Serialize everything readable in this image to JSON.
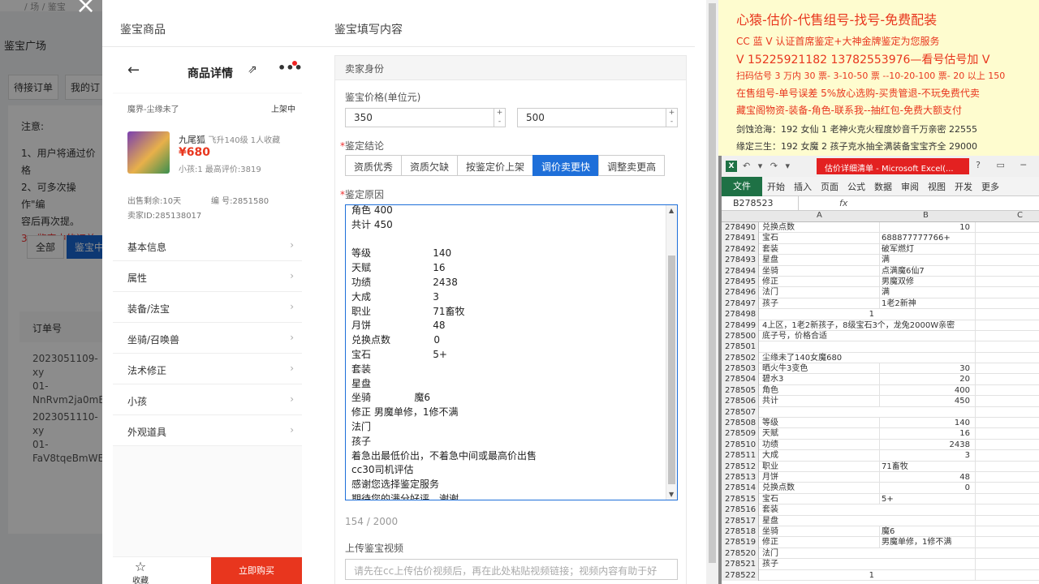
{
  "background": {
    "topbar": "/  场  /  鉴宝",
    "page_title": "鉴宝广场",
    "tabs": [
      "待接订单",
      "我的订"
    ],
    "notice_title": "注意:",
    "notice_lines": [
      "1、用户将通过价格",
      "2、可多次操作\"编",
      "容后再次提。"
    ],
    "notice_red": "3、鉴定中的订单",
    "filter_all": "全部",
    "filter_active": "鉴宝中",
    "order_header": "订单号",
    "orders": [
      [
        "2023051109-xy",
        "01-",
        "NnRvm2ja0mE"
      ],
      [
        "2023051110-xy",
        "01-",
        "FaV8tqeBmWE"
      ]
    ]
  },
  "modal": {
    "close_icon": "×",
    "left_header": "鉴宝商品",
    "right_header": "鉴宝填写内容"
  },
  "phone": {
    "back_icon": "←",
    "title": "商品详情",
    "share_icon": "⇗",
    "more_icon": "•••",
    "zone": "魔界-尘缘未了",
    "status": "上架中",
    "name": "九尾狐",
    "meta": "飞升140级   1人收藏",
    "price": "¥680",
    "child_info": "小孩:1 最高评价:3819",
    "remaining": "出售剩余:10天",
    "serial": "编 号:2851580",
    "seller_id": "卖家ID:285138017",
    "menu": [
      "基本信息",
      "属性",
      "装备/法宝",
      "坐骑/召唤兽",
      "法术修正",
      "小孩",
      "外观道具"
    ],
    "fav_icon": "☆",
    "fav_label": "收藏",
    "buy_label": "立即购买"
  },
  "form": {
    "section": "卖家身份",
    "price_label": "鉴宝价格(单位元)",
    "price_low": "350",
    "price_high": "500",
    "verdict_label": "鉴定结论",
    "verdicts": [
      "资质优秀",
      "资质欠缺",
      "按鉴定价上架",
      "调价卖更快",
      "调整卖更高"
    ],
    "active_verdict": 3,
    "reason_label": "鉴定原因",
    "reason_lines": [
      "角色 400",
      "共计 450",
      "",
      "等级                    140",
      "天赋                    16",
      "功绩                    2438",
      "大成                    3",
      "职业                    71畜牧",
      "月饼                    48",
      "兑换点数              0",
      "宝石                    5+",
      "套装",
      "星盘",
      "坐骑              魔6",
      "修正 男魔单修，1修不满",
      "法门",
      "孩子",
      "着急出最低价出，不着急中间或最高价出售",
      "cc30司机评估",
      "感谢您选择鉴定服务",
      "期待您的满分好评，谢谢"
    ],
    "counter": "154 / 2000",
    "video_label": "上传鉴宝视频",
    "video_placeholder": "请先在cc上传估价视频后，再在此处粘贴视频链接；视频内容有助于好"
  },
  "ad": {
    "line1": "心猿-估价-代售组号-找号-免费配装",
    "line2": "CC 蓝 V 认证首席鉴定+大神金牌鉴定为您服务",
    "line3": "V 15225921182     13782553976—看号估号加 V",
    "line4": "扫码估号 3 万内 30 票- 3-10-50 票  --10-20-100 票- 20 以上 150",
    "line5": "在售组号-单号误差 5%放心选购-买贵管退-不玩免费代卖",
    "line6": "藏宝阁物资-装备-角色-联系我--抽红包-免费大额支付",
    "line7": "剑蚀沧海：192 女仙 1 老神火克火程度妙音千万亲密 22555",
    "line8": "缘定三生：192 女魔 2 孩子克水抽全满装备宝宝齐全 29000"
  },
  "excel": {
    "qa": "↶ ▾ ↷ ▾",
    "filename": "估价详细清单 - Microsoft Excel(...",
    "win_controls": "?  ▭  ─",
    "file_tab": "文件",
    "tabs": [
      "开始",
      "插入",
      "页面",
      "公式",
      "数据",
      "审阅",
      "视图",
      "开发",
      "更多"
    ],
    "namebox": "B278523",
    "fx": "fx",
    "cols": [
      "A",
      "B",
      "C"
    ],
    "rows": [
      [
        "278490",
        "兑换点数",
        "10",
        "num"
      ],
      [
        "278491",
        "宝石",
        "688877777766+",
        "txt"
      ],
      [
        "278492",
        "套装",
        "破军燃灯",
        "txt"
      ],
      [
        "278493",
        "星盘",
        "满",
        "txt"
      ],
      [
        "278494",
        "坐骑",
        "点满魔6仙7",
        "txt"
      ],
      [
        "278495",
        "修正",
        "男魔双修",
        "txt"
      ],
      [
        "278496",
        "法门",
        "满",
        "txt"
      ],
      [
        "278497",
        "孩子",
        "1老2新神",
        "txt"
      ],
      [
        "278498",
        "",
        "1",
        "numA"
      ],
      [
        "278499",
        "4上区，1老2新孩子，8级宝石3个，龙兔2000W亲密",
        "",
        "txt"
      ],
      [
        "278500",
        "底子号，价格合适",
        "",
        "txt"
      ],
      [
        "278501",
        "",
        "",
        "txt"
      ],
      [
        "278502",
        "尘缘未了140女魔680",
        "",
        "txt"
      ],
      [
        "278503",
        "晒火牛3变色",
        "30",
        "num"
      ],
      [
        "278504",
        "碧水3",
        "20",
        "num"
      ],
      [
        "278505",
        "角色",
        "400",
        "num"
      ],
      [
        "278506",
        "共计",
        "450",
        "num"
      ],
      [
        "278507",
        "",
        "",
        "txt"
      ],
      [
        "278508",
        "等级",
        "140",
        "num"
      ],
      [
        "278509",
        "天赋",
        "16",
        "num"
      ],
      [
        "278510",
        "功绩",
        "2438",
        "num"
      ],
      [
        "278511",
        "大成",
        "3",
        "num"
      ],
      [
        "278512",
        "职业",
        "71畜牧",
        "txt"
      ],
      [
        "278513",
        "月饼",
        "48",
        "num"
      ],
      [
        "278514",
        "兑换点数",
        "0",
        "num"
      ],
      [
        "278515",
        "宝石",
        "5+",
        "txt"
      ],
      [
        "278516",
        "套装",
        "",
        "txt"
      ],
      [
        "278517",
        "星盘",
        "",
        "txt"
      ],
      [
        "278518",
        "坐骑",
        "魔6",
        "txt"
      ],
      [
        "278519",
        "修正",
        "男魔单修，1修不满",
        "txt"
      ],
      [
        "278520",
        "法门",
        "",
        "txt"
      ],
      [
        "278521",
        "孩子",
        "",
        "txt"
      ],
      [
        "278522",
        "",
        "1",
        "numA"
      ]
    ]
  }
}
